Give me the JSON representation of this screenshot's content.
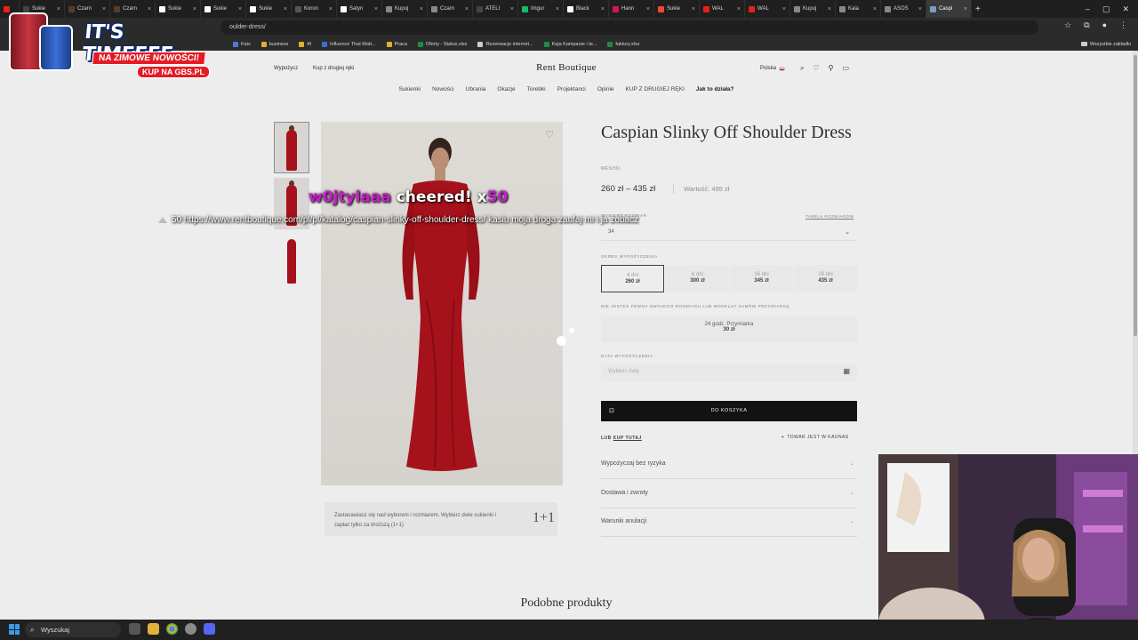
{
  "browser": {
    "tabs": [
      {
        "label": "",
        "color": "#e62117"
      },
      {
        "label": "Sukie",
        "color": "#444444"
      },
      {
        "label": "Czarn",
        "color": "#5a3b2a"
      },
      {
        "label": "Czarn",
        "color": "#5a3b2a"
      },
      {
        "label": "Sukie",
        "color": "#ffffff"
      },
      {
        "label": "Sukie",
        "color": "#ffffff"
      },
      {
        "label": "Sukie",
        "color": "#ffffff"
      },
      {
        "label": "Koron",
        "color": "#555555"
      },
      {
        "label": "Satyn",
        "color": "#ffffff"
      },
      {
        "label": "Kupuj",
        "color": "#888888"
      },
      {
        "label": "Czarn",
        "color": "#888888"
      },
      {
        "label": "ATELI",
        "color": "#444444"
      },
      {
        "label": "Imgur",
        "color": "#1bb76e"
      },
      {
        "label": "Black",
        "color": "#ffffff"
      },
      {
        "label": "Hann",
        "color": "#d4145a"
      },
      {
        "label": "Sukie",
        "color": "#ee4d2d"
      },
      {
        "label": "WAL",
        "color": "#e62117"
      },
      {
        "label": "WAL",
        "color": "#e62117"
      },
      {
        "label": "Kupuj",
        "color": "#888888"
      },
      {
        "label": "Kaia",
        "color": "#888888"
      },
      {
        "label": "ASOS",
        "color": "#888888"
      },
      {
        "label": "Caspi",
        "color": "#7b9bc4"
      }
    ],
    "url": "oulder-dress/",
    "bookmarks": [
      {
        "label": "Kaix",
        "color": "#4a7ae0"
      },
      {
        "label": "business",
        "color": "#e0b030"
      },
      {
        "label": "tft",
        "color": "#e0b030"
      },
      {
        "label": "Influence That Matt...",
        "color": "#3b6fd6"
      },
      {
        "label": "Praca",
        "color": "#e0b030"
      },
      {
        "label": "Oferty - Status.xlsx",
        "color": "#1d8b43"
      },
      {
        "label": "Rezerwacje internet...",
        "color": "#cccccc"
      },
      {
        "label": "Kaja Kampanie i te...",
        "color": "#1d8b43"
      },
      {
        "label": "faktury.xlsx",
        "color": "#1d8b43"
      }
    ],
    "all_bookmarks": "Wszystkie zakładki"
  },
  "site": {
    "logo": "Rent Boutique",
    "top_links": [
      "Wypożycz",
      "Kup z drugiej ręki"
    ],
    "language": "Polska",
    "nav": [
      "Sukienki",
      "Nowości",
      "Ubrania",
      "Okazje",
      "Torebki",
      "Projektanci",
      "Opinie",
      "KUP Z DRUGIEJ RĘKI",
      "Jak to działa?"
    ]
  },
  "product": {
    "title": "Caspian Slinky Off Shoulder Dress",
    "brand": "MESHKI",
    "price": "260 zł – 435 zł",
    "value": "Wartość: 495 zł",
    "size_label": "WYBIERZ ROZMIAR",
    "size_table": "TABELA ROZMIARÓW",
    "size_value": "34",
    "period_label": "OKRES WYPOŻYCZENIA",
    "periods": [
      {
        "days": "4 dni",
        "price": "260 zł"
      },
      {
        "days": "8 dni",
        "price": "300 zł"
      },
      {
        "days": "16 dni",
        "price": "345 zł"
      },
      {
        "days": "28 dni",
        "price": "435 zł"
      }
    ],
    "tryon_note": "NIE JESTEŚ PEWNA SWOJEGO ROZMIARU LUB MODELU? ZAMÓW PRZYMIARKĘ",
    "tryon_line": "24 godz. Przymiarka",
    "tryon_price": "30 zł",
    "date_label": "DATA WYPOŻYCZENIA",
    "date_placeholder": "Wybierz datę",
    "cart": "DO KOSZYKA",
    "buy_prefix": "LUB",
    "buy_link": "KUP TUTAJ",
    "store": "TOWAR JEST W KAUNAS",
    "accordions": [
      "Wypożyczaj bez ryzyka",
      "Dostawa i zwroty",
      "Warunki anulacji"
    ],
    "promo_text": "Zastanawiasz się nad wyborem i rozmiarem. Wybierz dwie sukienki i zapłać tylko za droższą (1+1)",
    "promo_badge": "1+1",
    "similar": "Podobne produkty"
  },
  "stream": {
    "ad_title": "IT'S TIMEEEE...",
    "ad_sub": "NA ZIMOWE NOWOŚCI!",
    "ad_cta": "KUP NA GBS.PL",
    "cheer_user": "w0jtylaaa",
    "cheer_text": "cheered! x",
    "cheer_amount": "50",
    "cheer_message": "50 https://www.rentboutique.com/pl/pl/katalog/caspian-slinky-off-shoulder-dress/ kasiu moja droga zaufaj mi i ja zobacz"
  },
  "taskbar": {
    "search": "Wyszukaj"
  },
  "colors": {
    "accent_cheer": "#c81ec8",
    "dress": "#b2141e",
    "button_dark": "#141414"
  }
}
